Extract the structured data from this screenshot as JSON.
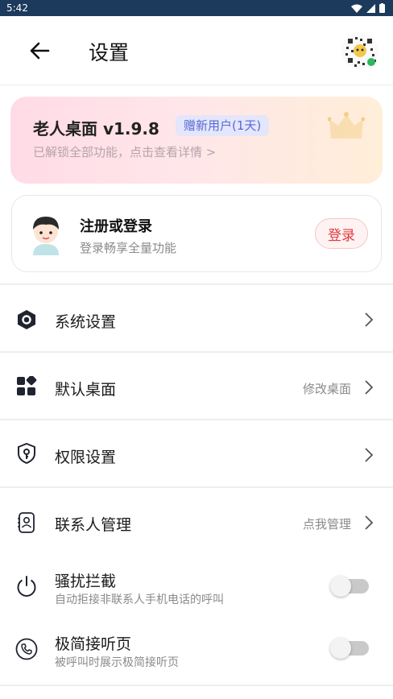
{
  "status_bar": {
    "time": "5:42"
  },
  "header": {
    "title": "设置"
  },
  "vip_card": {
    "title": "老人桌面 v1.9.8",
    "badge": "赠新用户(1天)",
    "subtitle": "已解锁全部功能，点击查看详情 >"
  },
  "login_card": {
    "title": "注册或登录",
    "subtitle": "登录畅享全量功能",
    "button": "登录"
  },
  "settings": {
    "system": {
      "label": "系统设置"
    },
    "default_desktop": {
      "label": "默认桌面",
      "value": "修改桌面"
    },
    "permissions": {
      "label": "权限设置"
    },
    "contacts": {
      "label": "联系人管理",
      "value": "点我管理"
    },
    "harassment": {
      "label": "骚扰拦截",
      "sub": "自动拒接非联系人手机电话的呼叫",
      "enabled": false
    },
    "simple_answer": {
      "label": "极简接听页",
      "sub": "被呼叫时展示极简接听页",
      "enabled": false
    }
  },
  "colors": {
    "accent_red": "#e23b3b",
    "badge_blue": "#5869d6",
    "status_bar": "#1b3a5c"
  }
}
